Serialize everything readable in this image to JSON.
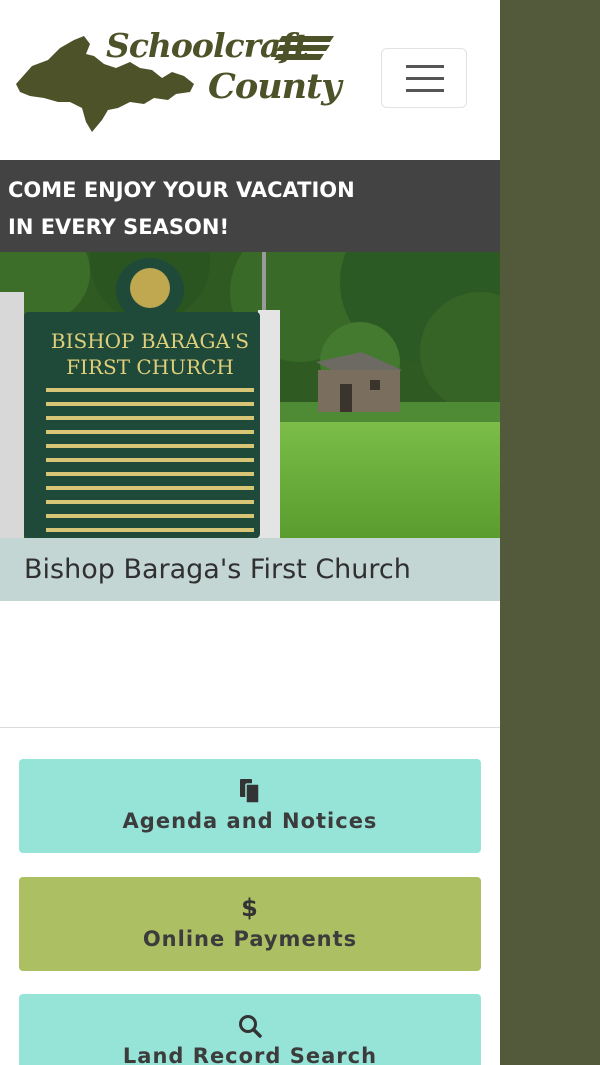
{
  "header": {
    "logo": {
      "line1": "Schoolcraft",
      "line2": "County"
    },
    "menu_toggle": {
      "icon": "hamburger-icon"
    }
  },
  "tagline": {
    "line1": "COME ENJOY YOUR VACATION",
    "line2": "IN EVERY SEASON!"
  },
  "hero": {
    "caption": "Bishop Baraga's First Church",
    "sign_title_1": "BISHOP BARAGA'S",
    "sign_title_2": "FIRST CHURCH"
  },
  "buttons": [
    {
      "label": "Agenda and Notices",
      "icon": "clipboard-icon",
      "color": "#96e4d8"
    },
    {
      "label": "Online Payments",
      "icon": "dollar-icon",
      "glyph": "$",
      "color": "#acbf63"
    },
    {
      "label": "Land Record Search",
      "icon": "search-icon",
      "color": "#96e4d8"
    }
  ],
  "colors": {
    "sidebar": "#535a3c",
    "tagline_bg": "#434343",
    "caption_bg": "#c3d6d3",
    "logo": "#4e5228"
  }
}
